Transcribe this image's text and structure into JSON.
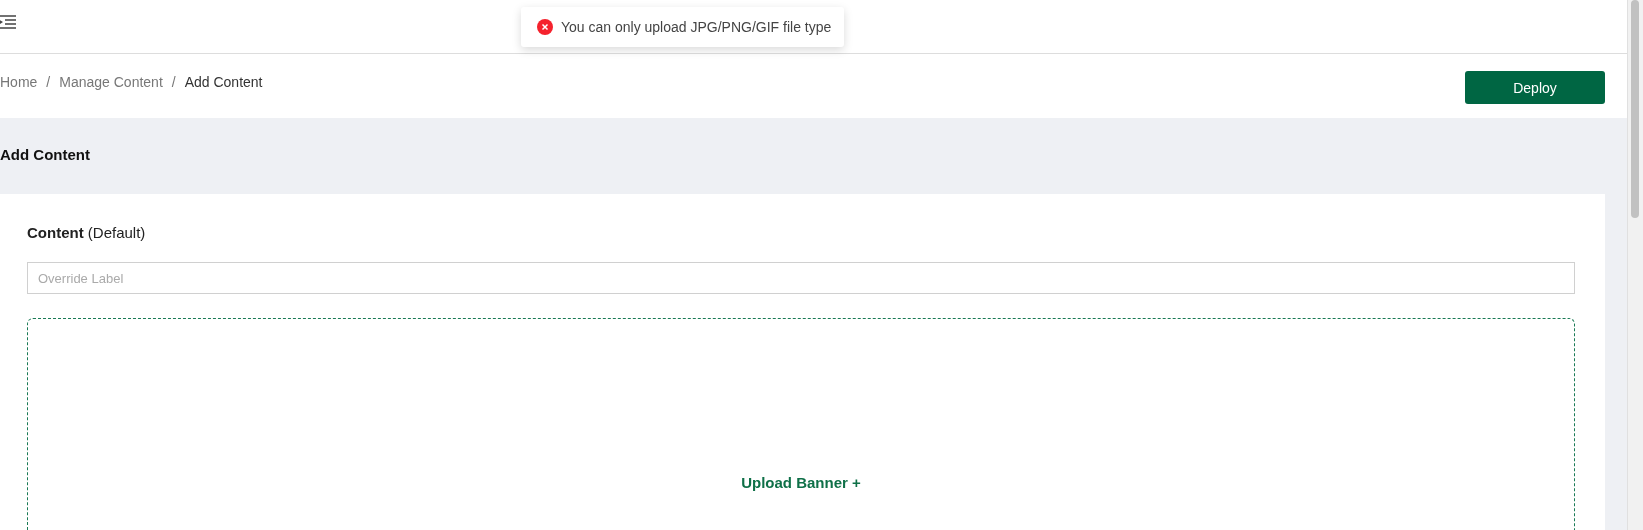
{
  "toast": {
    "kind": "error",
    "message": "You can only upload JPG/PNG/GIF file type"
  },
  "breadcrumb": [
    {
      "label": "Home",
      "current": false
    },
    {
      "label": "Manage Content",
      "current": false
    },
    {
      "label": "Add Content",
      "current": true
    }
  ],
  "breadcrumb_separator": "/",
  "deploy_button": "Deploy",
  "page_title": "Add Content",
  "section": {
    "title": "Content",
    "title_suffix": "(Default)",
    "override_field": {
      "placeholder": "Override Label"
    },
    "upload": {
      "label": "Upload Banner +"
    }
  }
}
